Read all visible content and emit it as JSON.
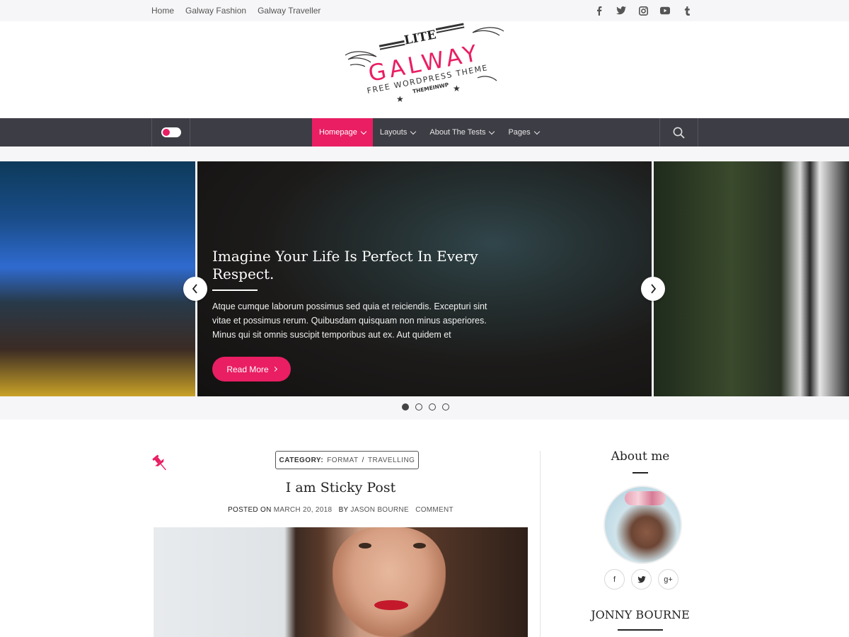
{
  "topbar": {
    "menu": [
      "Home",
      "Galway Fashion",
      "Galway Traveller"
    ],
    "social_icons": [
      "facebook-icon",
      "twitter-icon",
      "instagram-icon",
      "youtube-icon",
      "tumblr-icon"
    ]
  },
  "logo": {
    "lite": "LITE",
    "name": "GALWAY",
    "tagline": "FREE WORDPRESS THEME",
    "brand": "THEMEINWP"
  },
  "nav": {
    "items": [
      {
        "label": "Homepage",
        "active": true
      },
      {
        "label": "Layouts",
        "active": false
      },
      {
        "label": "About The Tests",
        "active": false
      },
      {
        "label": "Pages",
        "active": false
      }
    ],
    "accent": "#e91e63",
    "bar_color": "#3d3d45"
  },
  "slider": {
    "title": "Imagine Your Life Is Perfect In Every Respect.",
    "excerpt": "Atque cumque laborum possimus sed quia et reiciendis. Excepturi sint vitae et possimus rerum. Quibusdam quisquam non minus asperiores. Minus qui sit omnis suscipit temporibus aut ex. Aut quidem et",
    "button": "Read More",
    "dots_total": 4,
    "active_dot": 1
  },
  "post": {
    "category_label": "CATEGORY:",
    "categories": [
      "FORMAT",
      "TRAVELLING"
    ],
    "category_separator": "/",
    "title": "I am Sticky Post",
    "posted_on_label": "POSTED ON",
    "date": "MARCH 20, 2018",
    "by_label": "BY",
    "author": "JASON BOURNE",
    "comment": "COMMENT"
  },
  "sidebar": {
    "widget_title": "About me",
    "social": [
      "f",
      "t",
      "g+"
    ],
    "author_name": "JONNY BOURNE"
  }
}
